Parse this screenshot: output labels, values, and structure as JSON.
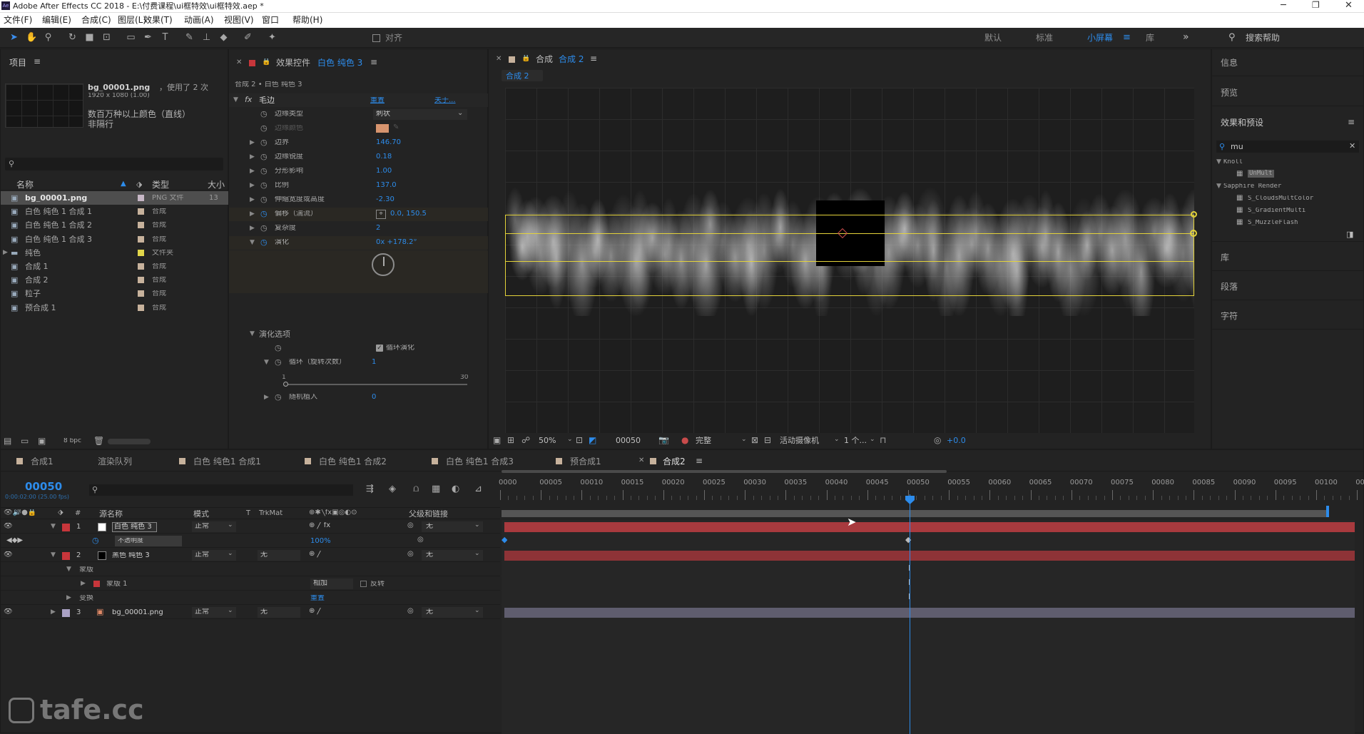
{
  "window": {
    "title": "Adobe After Effects CC 2018 - E:\\付费课程\\ui框特效\\ui框特效.aep *"
  },
  "menu": [
    "文件(F)",
    "编辑(E)",
    "合成(C)",
    "图层(L)",
    "效果(T)",
    "动画(A)",
    "视图(V)",
    "窗口",
    "帮助(H)"
  ],
  "toolbar": {
    "align_label": "对齐",
    "workspaces": [
      "默认",
      "标准",
      "小屏幕",
      "库"
    ],
    "active_workspace": "小屏幕",
    "search_help": "搜索帮助"
  },
  "project": {
    "title": "项目",
    "file_name": "bg_00001.png",
    "used": "，使用了 2 次",
    "dims": "1920 x 1080 (1.00)",
    "desc1": "数百万种以上颜色（直线）",
    "desc2": "非隔行",
    "search_placeholder": "",
    "columns": {
      "name": "名称",
      "type": "类型",
      "size": "大小"
    },
    "items": [
      {
        "name": "bg_00001.png",
        "type": "PNG 文件",
        "size": "13",
        "color": "#c7b7c6"
      },
      {
        "name": "白色 纯色 1 合成 1",
        "type": "合成",
        "color": "#c7b29c"
      },
      {
        "name": "白色 纯色 1 合成 2",
        "type": "合成",
        "color": "#c7b29c"
      },
      {
        "name": "白色 纯色 1 合成 3",
        "type": "合成",
        "color": "#c7b29c"
      },
      {
        "name": "纯色",
        "type": "文件夹",
        "color": "#e1d64a"
      },
      {
        "name": "合成 1",
        "type": "合成",
        "color": "#c7b29c"
      },
      {
        "name": "合成 2",
        "type": "合成",
        "color": "#c7b29c"
      },
      {
        "name": "粒子",
        "type": "合成",
        "color": "#c7b29c"
      },
      {
        "name": "预合成 1",
        "type": "合成",
        "color": "#c7b29c"
      }
    ],
    "bpc": "8 bpc"
  },
  "effects": {
    "panel_title": "效果控件",
    "layer_name": "白色 纯色 3",
    "breadcrumb": "合成 2 • 白色 纯色 3",
    "effect_name": "毛边",
    "reset": "重置",
    "about": "关于...",
    "props": [
      {
        "label": "边缘类型",
        "value": "刺状",
        "kind": "dropdown"
      },
      {
        "label": "边缘颜色",
        "value": "",
        "kind": "color",
        "disabled": true
      },
      {
        "label": "边界",
        "value": "146.70"
      },
      {
        "label": "边缘锐度",
        "value": "0.18"
      },
      {
        "label": "分形影响",
        "value": "1.00"
      },
      {
        "label": "比例",
        "value": "137.0"
      },
      {
        "label": "伸缩宽度或高度",
        "value": "-2.30"
      },
      {
        "label": "偏移（湍流）",
        "value": "0.0, 150.5",
        "kind": "point"
      },
      {
        "label": "复杂度",
        "value": "2"
      },
      {
        "label": "演化",
        "value": "0x +178.2°",
        "kind": "angle"
      }
    ],
    "evo_options": "演化选项",
    "cycle_label": "循环演化",
    "cycle_count_label": "循环（旋转次数）",
    "cycle_count": "1",
    "slider_min": "1",
    "slider_max": "30",
    "random_seed_label": "随机植入",
    "random_seed": "0"
  },
  "composition": {
    "title": "合成",
    "name": "合成 2",
    "tab": "合成 2",
    "zoom": "50%",
    "timecode": "00050",
    "resolution": "完整",
    "camera": "活动摄像机",
    "views": "1 个...",
    "exposure": "+0.0"
  },
  "right_panels": {
    "info": "信息",
    "preview": "预览",
    "effects_presets": "效果和预设",
    "search_value": "mu",
    "tree": [
      {
        "label": "Knoll",
        "indent": 0,
        "expanded": true
      },
      {
        "label": "UnMult",
        "indent": 1,
        "selected": true
      },
      {
        "label": "Sapphire Render",
        "indent": 0,
        "expanded": true
      },
      {
        "label": "S_CloudsMultColor",
        "indent": 1
      },
      {
        "label": "S_GradientMulti",
        "indent": 1
      },
      {
        "label": "S_MuzzleFlash",
        "indent": 1
      }
    ],
    "library": "库",
    "paragraph": "段落",
    "character": "字符"
  },
  "timeline": {
    "tabs": [
      "合成1",
      "渲染队列",
      "白色 纯色1 合成1",
      "白色 纯色1 合成2",
      "白色 纯色1 合成3",
      "预合成1",
      "合成2"
    ],
    "active_tab": "合成2",
    "current_time": "00050",
    "time_sub": "0:00:02:00 (25.00 fps)",
    "columns": {
      "source": "源名称",
      "mode": "模式",
      "t": "T",
      "trkmat": "TrkMat",
      "parent": "父级和链接"
    },
    "ruler": [
      "0000",
      "00005",
      "00010",
      "00015",
      "00020",
      "00025",
      "00030",
      "00035",
      "00040",
      "00045",
      "00050",
      "00055",
      "00060",
      "00065",
      "00070",
      "00075",
      "00080",
      "00085",
      "00090",
      "00095",
      "00100",
      "00"
    ],
    "layers": [
      {
        "num": "1",
        "name": "白色 纯色 3",
        "mode": "正常",
        "trk": "",
        "parent": "无",
        "color": "#c7363b",
        "swatch": "#ffffff",
        "bar": "#a83a3e"
      },
      {
        "num": "",
        "name": "不透明度",
        "mode": "",
        "trk": "",
        "parent": "",
        "value": "100%",
        "sub": true
      },
      {
        "num": "2",
        "name": "黑色 纯色 3",
        "mode": "正常",
        "trk": "无",
        "parent": "无",
        "color": "#c7363b",
        "swatch": "#000000",
        "bar": "#8e3337"
      },
      {
        "num": "",
        "name": "蒙版",
        "sub": true,
        "group": true
      },
      {
        "num": "",
        "name": "蒙版 1",
        "sub": true,
        "mask": true,
        "mask_mode": "相加",
        "invert": "反转"
      },
      {
        "num": "",
        "name": "变换",
        "sub": true,
        "group": true,
        "reset": "重置"
      },
      {
        "num": "3",
        "name": "bg_00001.png",
        "mode": "正常",
        "trk": "无",
        "parent": "无",
        "color": "#a9a1c4",
        "swatch": "",
        "bar": "#5f5d6e"
      }
    ]
  },
  "watermark": "tafe.cc"
}
